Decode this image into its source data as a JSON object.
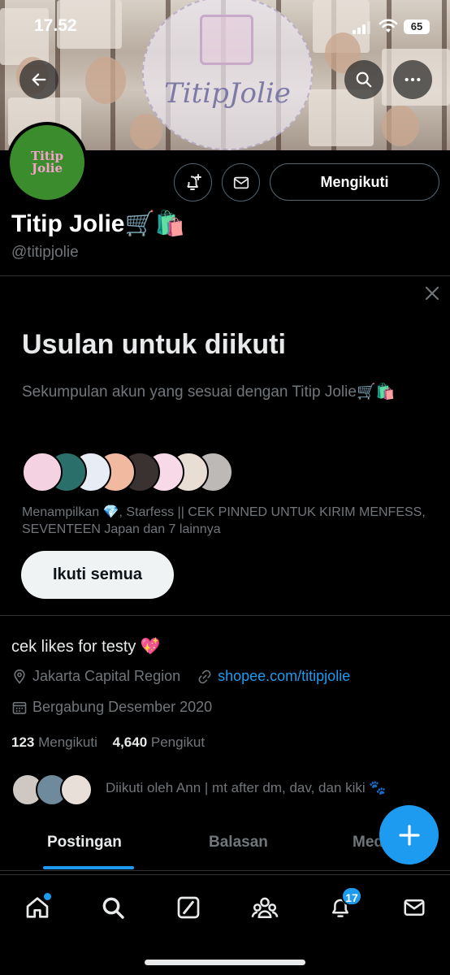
{
  "status_bar": {
    "time": "17.52",
    "battery": "65"
  },
  "banner": {
    "watermark_text": "TitipJolie"
  },
  "profile": {
    "avatar_text_line1": "Titip",
    "avatar_text_line2": "Jolie",
    "name": "Titip Jolie🛒🛍️",
    "handle": "@titipjolie",
    "follow_label": "Mengikuti",
    "bio": "cek likes for testy 💖",
    "location": "Jakarta Capital Region",
    "website": "shopee.com/titipjolie",
    "joined": "Bergabung Desember 2020",
    "following_count": "123",
    "following_label": "Mengikuti",
    "followers_count": "4,640",
    "followers_label": "Pengikut",
    "followed_by": "Diikuti oleh Ann | mt after dm, dav, dan kiki 🐾"
  },
  "suggestions": {
    "title": "Usulan untuk diikuti",
    "description": "Sekumpulan akun yang sesuai dengan Titip Jolie🛒🛍️",
    "showing": "Menampilkan 💎, Starfess || CEK PINNED UNTUK KIRIM MENFESS, SEVENTEEN Japan dan 7 lainnya",
    "follow_all": "Ikuti semua",
    "avatar_colors": [
      "#f4d2e2",
      "#2b6f6a",
      "#e8ecf5",
      "#f0b9a0",
      "#3a3230",
      "#f7d9e8",
      "#e9ded4",
      "#bdb9b6"
    ]
  },
  "tabs": [
    {
      "label": "Postingan"
    },
    {
      "label": "Balasan"
    },
    {
      "label": "Media"
    }
  ],
  "nav": {
    "notifications_badge": "17"
  },
  "colors": {
    "accent": "#1d9bf0",
    "muted": "#71767b",
    "divider": "#2f3336"
  }
}
